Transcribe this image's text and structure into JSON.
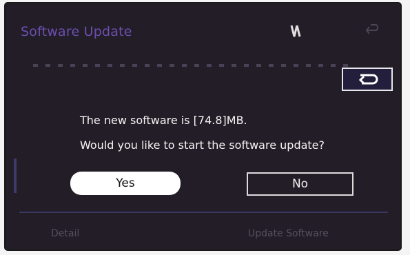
{
  "header": {
    "title": "Software Update",
    "center_icon": "network-update-icon",
    "right_icon": "back-arrow-icon"
  },
  "dialog": {
    "line1": "The new software is [74.8]MB.",
    "line2": "Would you like to start the software update?",
    "yes_label": "Yes",
    "no_label": "No",
    "back_icon": "return-arrow-icon"
  },
  "bottom_bar": {
    "detail_label": "Detail",
    "update_label": "Update Software"
  },
  "colors": {
    "background": "#231d27",
    "title_purple": "#6a4fb0",
    "yes_button": "#ffffff"
  }
}
